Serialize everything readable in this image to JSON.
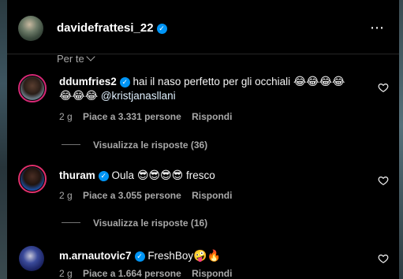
{
  "header": {
    "username": "davidefrattesi_22",
    "more_icon": "⋯"
  },
  "filter": {
    "label": "Per te"
  },
  "comments": [
    {
      "username": "ddumfries2",
      "text": "hai il naso perfetto per gli occhiali",
      "emojis_1": "😂😂😂😂",
      "emojis_2": "😂😂😂",
      "mention": "@kristjanasllani",
      "time": "2 g",
      "likes": "Piace a 3.331 persone",
      "reply": "Rispondi",
      "view_replies": "Visualizza le risposte (36)"
    },
    {
      "username": "thuram",
      "text": "Oula",
      "emojis": "😎😎😎😎",
      "text_after": "fresco",
      "time": "2 g",
      "likes": "Piace a 3.055 persone",
      "reply": "Rispondi",
      "view_replies": "Visualizza le risposte (16)"
    },
    {
      "username": "m.arnautovic7",
      "text": "FreshBoy",
      "emojis": "🤪🔥",
      "time": "2 g",
      "likes": "Piace a 1.664 persone",
      "reply": "Rispondi"
    }
  ],
  "colors": {
    "verified": "#0095f6",
    "background": "#000000",
    "muted": "#a8a8a8"
  }
}
